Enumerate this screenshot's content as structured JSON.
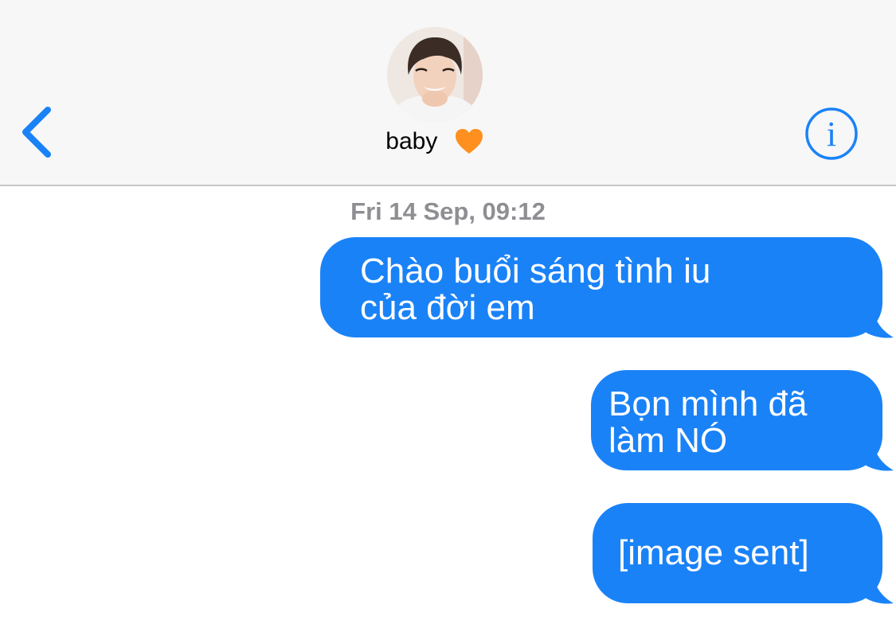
{
  "header": {
    "contact_name": "baby",
    "heart_color": "#ff8f1f",
    "accent_color": "#1a82f7",
    "back_icon": "chevron-left-icon",
    "info_icon": "info-icon"
  },
  "conversation": {
    "timestamp": "Fri 14 Sep, 09:12",
    "bubble_color": "#1a82f7",
    "messages": [
      {
        "sender": "me",
        "text": "Chào buổi sáng tình iu\ncủa đời em"
      },
      {
        "sender": "me",
        "text": "Bọn mình đã\nlàm NÓ"
      },
      {
        "sender": "me",
        "text": "[image sent]"
      }
    ]
  }
}
